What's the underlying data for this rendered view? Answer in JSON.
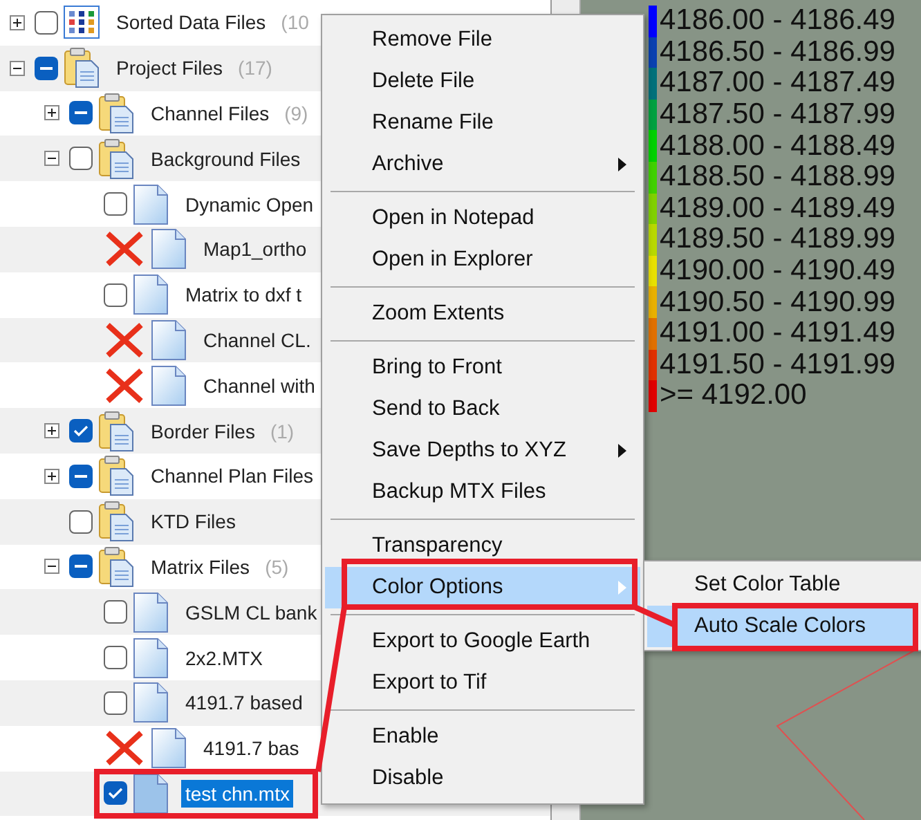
{
  "tree": [
    {
      "label": "Sorted Data Files",
      "count": "(10",
      "kind": "dataset",
      "checked": false,
      "expanded": false
    },
    {
      "label": "Project Files",
      "count": "(17)",
      "kind": "group",
      "partial": true,
      "expanded": true,
      "children": [
        {
          "label": "Channel Files",
          "count": "(9)",
          "kind": "group",
          "partial": true,
          "expanded": false
        },
        {
          "label": "Background Files",
          "kind": "group",
          "checked": false,
          "expanded": true,
          "children": [
            {
              "label": "Dynamic Open",
              "kind": "file",
              "checked": false
            },
            {
              "label": "Map1_ortho",
              "kind": "file",
              "missing": true
            },
            {
              "label": "Matrix to dxf t",
              "kind": "file",
              "checked": false
            },
            {
              "label": "Channel CL.",
              "kind": "file",
              "missing": true
            },
            {
              "label": "Channel with",
              "kind": "file",
              "missing": true
            }
          ]
        },
        {
          "label": "Border Files",
          "count": "(1)",
          "kind": "group",
          "checked": true,
          "expanded": false
        },
        {
          "label": "Channel Plan Files",
          "kind": "group",
          "partial": true,
          "expanded": false
        },
        {
          "label": "KTD Files",
          "kind": "group",
          "checked": false
        },
        {
          "label": "Matrix Files",
          "count": "(5)",
          "kind": "group",
          "partial": true,
          "expanded": true,
          "children": [
            {
              "label": "GSLM CL bank",
              "kind": "file",
              "checked": false,
              "selected": false
            },
            {
              "label": "2x2.MTX",
              "kind": "file",
              "checked": false,
              "selected": false
            },
            {
              "label": "4191.7 based",
              "kind": "file",
              "checked": false,
              "selected": false
            },
            {
              "label": "4191.7 bas",
              "kind": "file",
              "missing": true,
              "selected": false
            },
            {
              "label": "test chn.mtx",
              "kind": "file",
              "checked": true,
              "selected": true
            }
          ]
        }
      ]
    }
  ],
  "legend": [
    {
      "label": "4186.00 - 4186.49",
      "color": "#0000ff"
    },
    {
      "label": "4186.50 - 4186.99",
      "color": "#0a40b0"
    },
    {
      "label": "4187.00 - 4187.49",
      "color": "#00707a"
    },
    {
      "label": "4187.50 - 4187.99",
      "color": "#00a040"
    },
    {
      "label": "4188.00 - 4188.49",
      "color": "#00d000"
    },
    {
      "label": "4188.50 - 4188.99",
      "color": "#40d000"
    },
    {
      "label": "4189.00 - 4189.49",
      "color": "#80d000"
    },
    {
      "label": "4189.50 - 4189.99",
      "color": "#b8d800"
    },
    {
      "label": "4190.00 - 4190.49",
      "color": "#e8e000"
    },
    {
      "label": "4190.50 - 4190.99",
      "color": "#e8b000"
    },
    {
      "label": "4191.00 - 4191.49",
      "color": "#e07000"
    },
    {
      "label": "4191.50 - 4191.99",
      "color": "#e03000"
    },
    {
      "label": ">= 4192.00",
      "color": "#e00000"
    }
  ],
  "context_menu": [
    {
      "kind": "item",
      "label": "Remove File",
      "selected": false
    },
    {
      "kind": "item",
      "label": "Delete File",
      "selected": false
    },
    {
      "kind": "item",
      "label": "Rename File",
      "selected": false
    },
    {
      "kind": "item",
      "label": "Archive",
      "submenu": true,
      "selected": false
    },
    {
      "kind": "separator"
    },
    {
      "kind": "item",
      "label": "Open in Notepad",
      "selected": false
    },
    {
      "kind": "item",
      "label": "Open in Explorer",
      "selected": false
    },
    {
      "kind": "separator"
    },
    {
      "kind": "item",
      "label": "Zoom Extents",
      "selected": false
    },
    {
      "kind": "separator"
    },
    {
      "kind": "item",
      "label": "Bring to Front",
      "selected": false
    },
    {
      "kind": "item",
      "label": "Send to Back",
      "selected": false
    },
    {
      "kind": "item",
      "label": "Save Depths to XYZ",
      "submenu": true,
      "selected": false
    },
    {
      "kind": "item",
      "label": "Backup MTX Files",
      "selected": false
    },
    {
      "kind": "separator"
    },
    {
      "kind": "item",
      "label": "Transparency",
      "selected": false
    },
    {
      "kind": "item",
      "label": "Color Options",
      "submenu": true,
      "selected": true
    },
    {
      "kind": "separator"
    },
    {
      "kind": "item",
      "label": "Export to Google Earth",
      "selected": false
    },
    {
      "kind": "item",
      "label": "Export to Tif",
      "selected": false
    },
    {
      "kind": "separator"
    },
    {
      "kind": "item",
      "label": "Enable",
      "selected": false
    },
    {
      "kind": "item",
      "label": "Disable",
      "selected": false
    }
  ],
  "submenu": [
    {
      "label": "Set Color Table",
      "selected": false
    },
    {
      "label": "Auto Scale Colors",
      "selected": true
    }
  ]
}
